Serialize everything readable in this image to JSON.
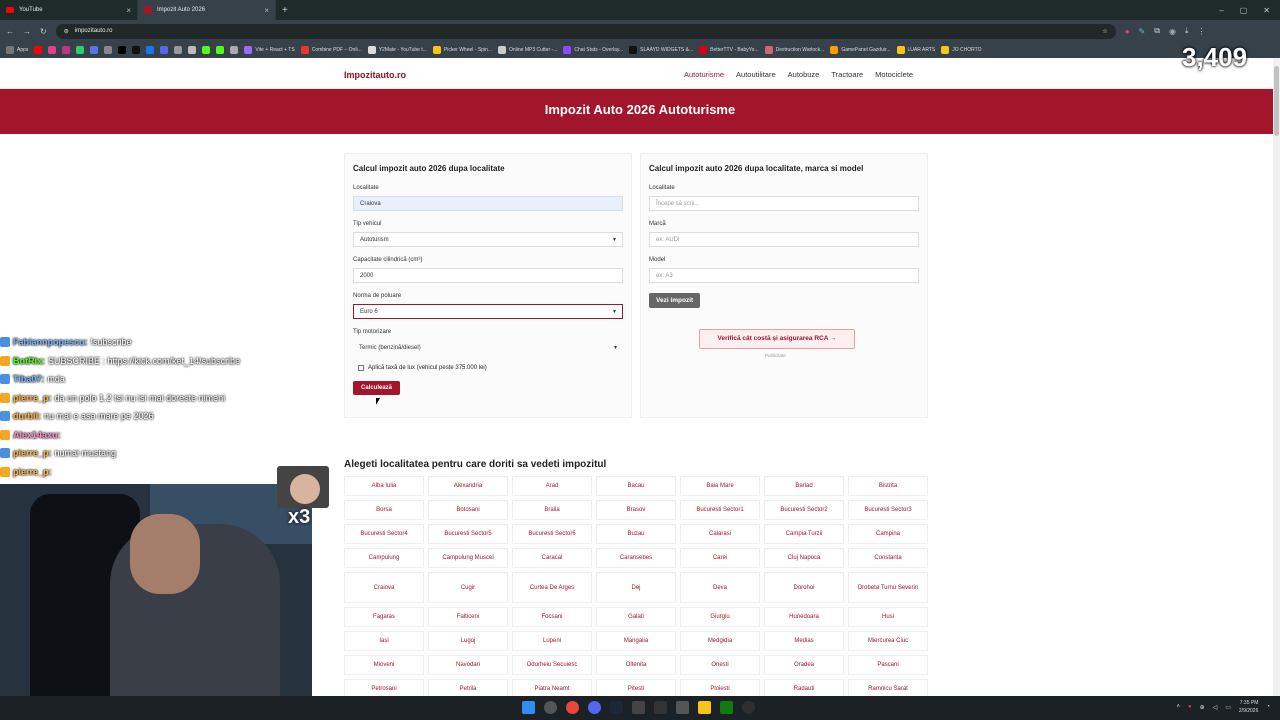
{
  "tabs": [
    {
      "label": "YouTube",
      "icon_color": "#ff0000"
    },
    {
      "label": "Impozit Auto 2026",
      "icon_color": "#a3152a"
    }
  ],
  "url": "impozitauto.ro",
  "bookmarks": [
    "Apps",
    "Vite + React + TS",
    "Combine PDF – Onli...",
    "Y2Mate - YouTube t...",
    "Picker Wheel - Spin...",
    "Online MP3 Cutter -...",
    "Chat Stats - Overlay...",
    "SLAAYD WIDGETS &...",
    "BetterTTV - BabyYo...",
    "Destruction Warlock...",
    "GamePanel Gazduir...",
    "LUAR ARTS",
    "JO CHORTO"
  ],
  "viewer_counter": "3,409",
  "site": {
    "logo": "Impozitauto.ro",
    "nav": [
      "Autoturisme",
      "Autoutilitare",
      "Autobuze",
      "Tractoare",
      "Motociclete"
    ],
    "hero_title": "Impozit Auto 2026 Autoturisme"
  },
  "card_left": {
    "title": "Calcul impozit auto 2026 dupa localitate",
    "localitate_label": "Localitate",
    "localitate_value": "Craiova",
    "tip_vehicul_label": "Tip vehicul",
    "tip_vehicul_value": "Autoturism",
    "capacitate_label": "Capacitate cilindrică (cm³)",
    "capacitate_value": "2000",
    "norma_label": "Norma de poluare",
    "norma_value": "Euro 6",
    "motorizare_label": "Tip motorizare",
    "motorizare_value": "Termic (benzină/diesel)",
    "lux_label": "Aplică taxă de lux (vehicul peste 375.000 lei)",
    "submit_label": "Calculează"
  },
  "card_right": {
    "title": "Calcul impozit auto 2026 dupa localitate, marca si model",
    "localitate_label": "Localitate",
    "localitate_placeholder": "Începe să scrii...",
    "marca_label": "Marcă",
    "marca_placeholder": "ex: AUDI",
    "model_label": "Model",
    "model_placeholder": "ex: A3",
    "button_label": "Vezi impozit",
    "rca_label": "Verifică cât costă și asigurarea RCA →",
    "ad_label": "Publicitate"
  },
  "cities_title": "Alegeti localitatea pentru care doriti sa vedeti impozitul",
  "cities": [
    "Alba Iulia",
    "Alexandria",
    "Arad",
    "Bacau",
    "Baia Mare",
    "Barlad",
    "Bistrita",
    "Borsa",
    "Botosani",
    "Braila",
    "Brasov",
    "Bucuresti Sector1",
    "Bucuresti Sector2",
    "Bucuresti Sector3",
    "Bucuresti Sector4",
    "Bucuresti Sector5",
    "Bucuresti Sector6",
    "Buzau",
    "Calarasi",
    "Campia Turzii",
    "Campina",
    "Campulung",
    "Campulung Muscel",
    "Caracal",
    "Caransebes",
    "Carei",
    "Cluj Napoca",
    "Constanta",
    "Craiova",
    "Cugir",
    "Curtea De Arges",
    "Dej",
    "Deva",
    "Dorohoi",
    "Drobeta Turnu Severin",
    "Fagaras",
    "Falticeni",
    "Focsani",
    "Galati",
    "Giurgiu",
    "Hunedoara",
    "Husi",
    "Iasi",
    "Lugoj",
    "Lupeni",
    "Mangalia",
    "Medgidia",
    "Medias",
    "Miercurea Ciuc",
    "Mioveni",
    "Navodari",
    "Odorheiu Secuiesc",
    "Oltenita",
    "Onesti",
    "Oradea",
    "Pascani",
    "Petrosani",
    "Petrila",
    "Piatra Neamt",
    "Pitesti",
    "Ploiesti",
    "Radauti",
    "Ramnicu Sarat"
  ],
  "chat": [
    {
      "user": "Fabiannpopescu:",
      "msg": "!subscribe",
      "color": "#7ab8ff"
    },
    {
      "user": "BotRix:",
      "msg": "SUBSCRIBE : https://kick.com/ket_14/subscribe",
      "color": "#53fc18"
    },
    {
      "user": "Tiba07:",
      "msg": "mda",
      "color": "#7ab8ff"
    },
    {
      "user": "pierre_p:",
      "msg": "da un polo 1.2 tsi nu isi mai doreste nimeni",
      "color": "#ffb347"
    },
    {
      "user": "durbii:",
      "msg": "nu mai e asa mare pe 2026",
      "color": "#ffb347"
    },
    {
      "user": "Alex14axu:",
      "msg": "",
      "color": "#ff8cc6"
    },
    {
      "user": "pierre_p:",
      "msg": "numai mustang",
      "color": "#ffb347"
    },
    {
      "user": "pierre_p:",
      "msg": "",
      "color": "#ffb347"
    }
  ],
  "emote_multiplier": "x3",
  "clock": {
    "time": "7:35 PM",
    "date": "2/9/2026"
  }
}
